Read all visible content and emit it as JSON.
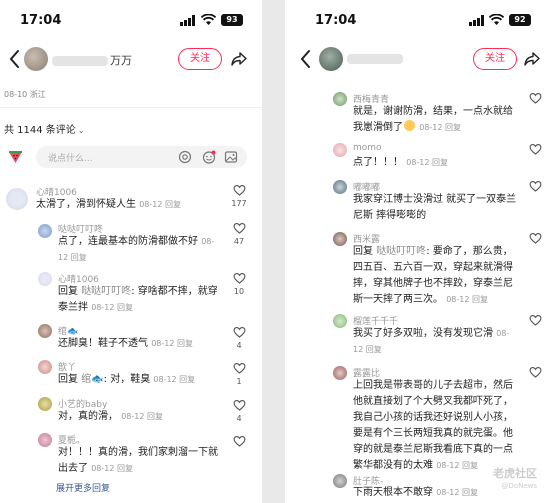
{
  "left": {
    "status": {
      "time": "17:04",
      "battery": "93"
    },
    "nav": {
      "name_suffix": "万万",
      "follow_label": "关注"
    },
    "post_meta": "08-10 浙江",
    "comment_count": "共 1144 条评论",
    "input_placeholder": "说点什么...",
    "comments": [
      {
        "name": "心晴1006",
        "text": "太滑了，滑到怀疑人生",
        "time": "08-12 回复",
        "likes": "177"
      },
      {
        "name": "哒哒叮叮咚",
        "text": "点了，连最基本的防滑都做不好",
        "time": "08-12 回复",
        "likes": "47"
      },
      {
        "name": "心晴1006",
        "reply_prefix": "回复 ",
        "reply_to": "哒哒叮叮咚",
        "text": ": 穿啥都不摔，就穿泰兰拌",
        "time": "08-12 回复",
        "likes": "10"
      },
      {
        "name": "绾",
        "text": "还脚臭！鞋子不透气",
        "time": "08-12 回复",
        "likes": "4"
      },
      {
        "name": "歆丫",
        "reply_prefix": "回复 ",
        "reply_to": "绾",
        "text": ": 对，鞋臭",
        "time": "08-12 回复",
        "likes": "1"
      },
      {
        "name": "小艺的baby",
        "text": "对，真的滑，",
        "time": "08-12 回复",
        "likes": "4"
      },
      {
        "name": "夏栀。",
        "text": "对！！！真的滑，我们家刺溜一下就出去了",
        "time": "08-12 回复",
        "likes": ""
      }
    ],
    "expand_label": "展开更多回复"
  },
  "right": {
    "status": {
      "time": "17:04",
      "battery": "92"
    },
    "nav": {
      "follow_label": "关注"
    },
    "comments": [
      {
        "name": "西梅青青",
        "text": "就是，谢谢防滑，结果，一点水就给我崽滑倒了",
        "time": "08-12 回复",
        "likes": ""
      },
      {
        "name": "momo",
        "text": "点了！！！",
        "time": "08-12 回复",
        "likes": ""
      },
      {
        "name": "嘟嘟嘟",
        "text": "我家穿江博士没滑过 就买了一双泰兰尼斯 摔得嘭嘭的",
        "time": "08-12 回复",
        "likes": ""
      },
      {
        "name": "西米露",
        "reply_prefix": "回复 ",
        "reply_to": "哒哒叮叮咚",
        "text": ": 要命了，那么贵，四五百、五六百一双，穿起来就滑得摔，穿其他牌子也不摔跤，穿泰兰尼斯一天摔了两三次。",
        "time": "08-12 回复",
        "likes": ""
      },
      {
        "name": "榴莲千千千",
        "text": "我买了好多双啦，没有发现它滑",
        "time": "08-12 回复",
        "likes": ""
      },
      {
        "name": "露露比",
        "text": "上回我是带表哥的儿子去超市，然后他就直接划了个大劈叉我都吓死了，我自己小孩的话我还好说别人小孩，要是有个三长两短我真的就完蛋。他穿的就是泰兰尼斯我看底下真的一点繁华都没有的太难",
        "time": "08-12 回复",
        "likes": ""
      },
      {
        "name": "肚子陈-",
        "text": "下雨天根本不敢穿",
        "time": "08-12 回复",
        "likes": ""
      }
    ]
  },
  "watermark": {
    "brand": "老虎社区",
    "sub": "@DoNews"
  },
  "colors": {
    "accent": "#ff2d55",
    "link": "#3a5a8c",
    "meta": "#999999"
  }
}
